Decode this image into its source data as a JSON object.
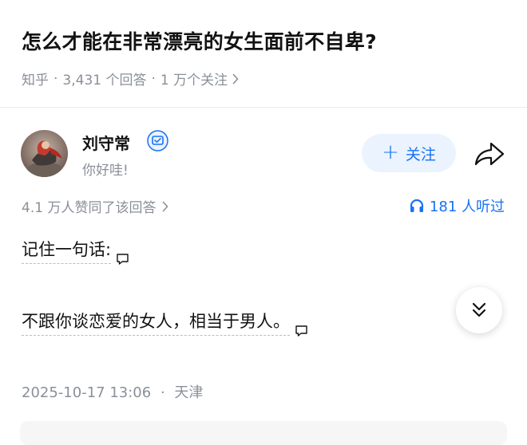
{
  "question": {
    "title": "怎么才能在非常漂亮的女生面前不自卑?",
    "source": "知乎",
    "answers": "3,431 个回答",
    "followers": "1 万个关注"
  },
  "author": {
    "name": "刘守常",
    "bio": "你好哇!",
    "follow_label": "关注"
  },
  "answer": {
    "upvotes": "4.1 万人赞同了该回答",
    "listen_count": "181 人听过",
    "paragraphs": [
      "记住一句话:",
      "不跟你谈恋爱的女人，相当于男人。"
    ],
    "date": "2025-10-17 13:06",
    "location": "天津"
  },
  "colors": {
    "accent": "#1772f6",
    "follow_bg": "#ebf3fe",
    "muted": "#8a8f99"
  },
  "icons": [
    "verified-badge-icon",
    "share-icon",
    "headphones-icon",
    "comment-icon",
    "double-chevron-down-icon",
    "chevron-right-icon"
  ]
}
